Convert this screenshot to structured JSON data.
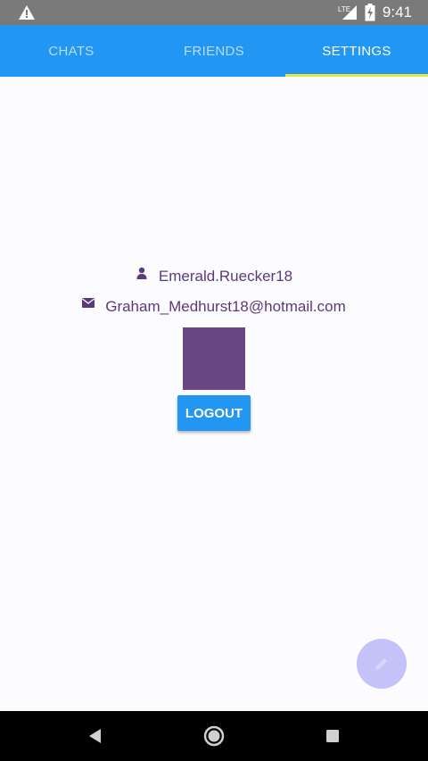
{
  "status_bar": {
    "time": "9:41",
    "network": "LTE",
    "icons": [
      "warning-icon",
      "signal-icon",
      "battery-charging-icon"
    ]
  },
  "tabs": [
    {
      "label": "CHATS",
      "active": false
    },
    {
      "label": "FRIENDS",
      "active": false
    },
    {
      "label": "SETTINGS",
      "active": true
    }
  ],
  "profile": {
    "username": "Emerald.Ruecker18",
    "email": "Graham_Medhurst18@hotmail.com",
    "user_icon": "person-icon",
    "email_icon": "envelope-icon"
  },
  "logout_label": "LOGOUT",
  "fab_icon": "pencil-icon",
  "colors": {
    "primary": "#2196f3",
    "tab_indicator": "#e6e64a",
    "profile_text": "#5b3a7a",
    "avatar": "#6a4682",
    "fab": "#c3c3fa"
  },
  "nav_bar": {
    "icons": [
      "back-icon",
      "home-icon",
      "recents-icon"
    ]
  }
}
